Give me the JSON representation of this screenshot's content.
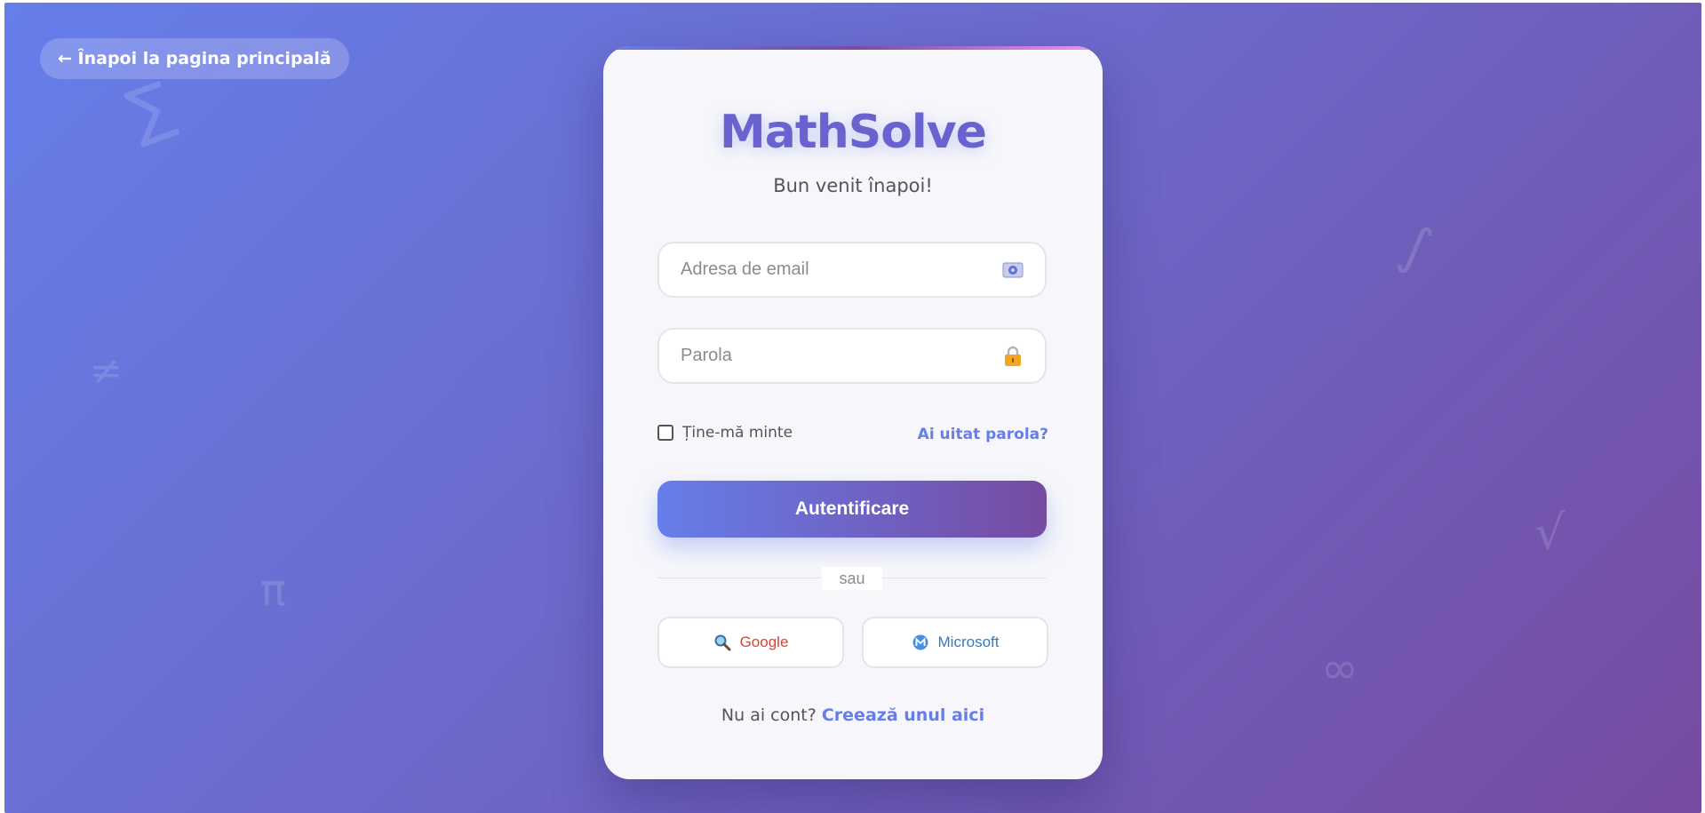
{
  "back_link": {
    "label": "← Înapoi la pagina principală"
  },
  "brand": {
    "name": "MathSolve",
    "welcome": "Bun venit înapoi!"
  },
  "form": {
    "email_placeholder": "Adresa de email",
    "email_value": "",
    "email_icon": "email-icon",
    "password_placeholder": "Parola",
    "password_value": "",
    "password_icon": "lock-icon",
    "remember_label": "Ține-mă minte",
    "remember_checked": false,
    "forgot_label": "Ai uitat parola?",
    "submit_label": "Autentificare"
  },
  "divider": {
    "label": "sau"
  },
  "social": {
    "google_label": "Google",
    "google_icon": "magnifier-icon",
    "microsoft_label": "Microsoft",
    "microsoft_icon": "microsoft-icon"
  },
  "signup": {
    "prompt": "Nu ai cont?",
    "link_label": "Creează unul aici"
  },
  "background_symbols": [
    "∑",
    "≠",
    "π",
    "∫",
    "√",
    "∞"
  ],
  "colors": {
    "gradient_start": "#667eea",
    "gradient_end": "#764ba2",
    "accent": "#667eea",
    "google": "#d64535",
    "microsoft": "#2a7bd1"
  }
}
